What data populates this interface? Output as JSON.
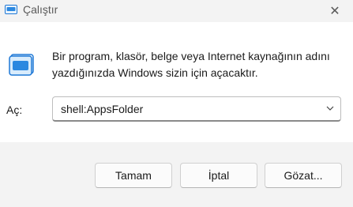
{
  "window": {
    "title": "Çalıştır",
    "close_glyph": "✕",
    "icon": "run-icon"
  },
  "dialog": {
    "description": "Bir program, klasör, belge veya Internet kaynağının adını yazdığınızda Windows sizin için açacaktır.",
    "open_label": "Aç:",
    "open_value": "shell:AppsFolder"
  },
  "buttons": {
    "ok": "Tamam",
    "cancel": "İptal",
    "browse": "Gözat..."
  },
  "colors": {
    "accent": "#1e78d6",
    "content_bg": "#ffffff",
    "frame_bg": "#f3f3f3"
  }
}
